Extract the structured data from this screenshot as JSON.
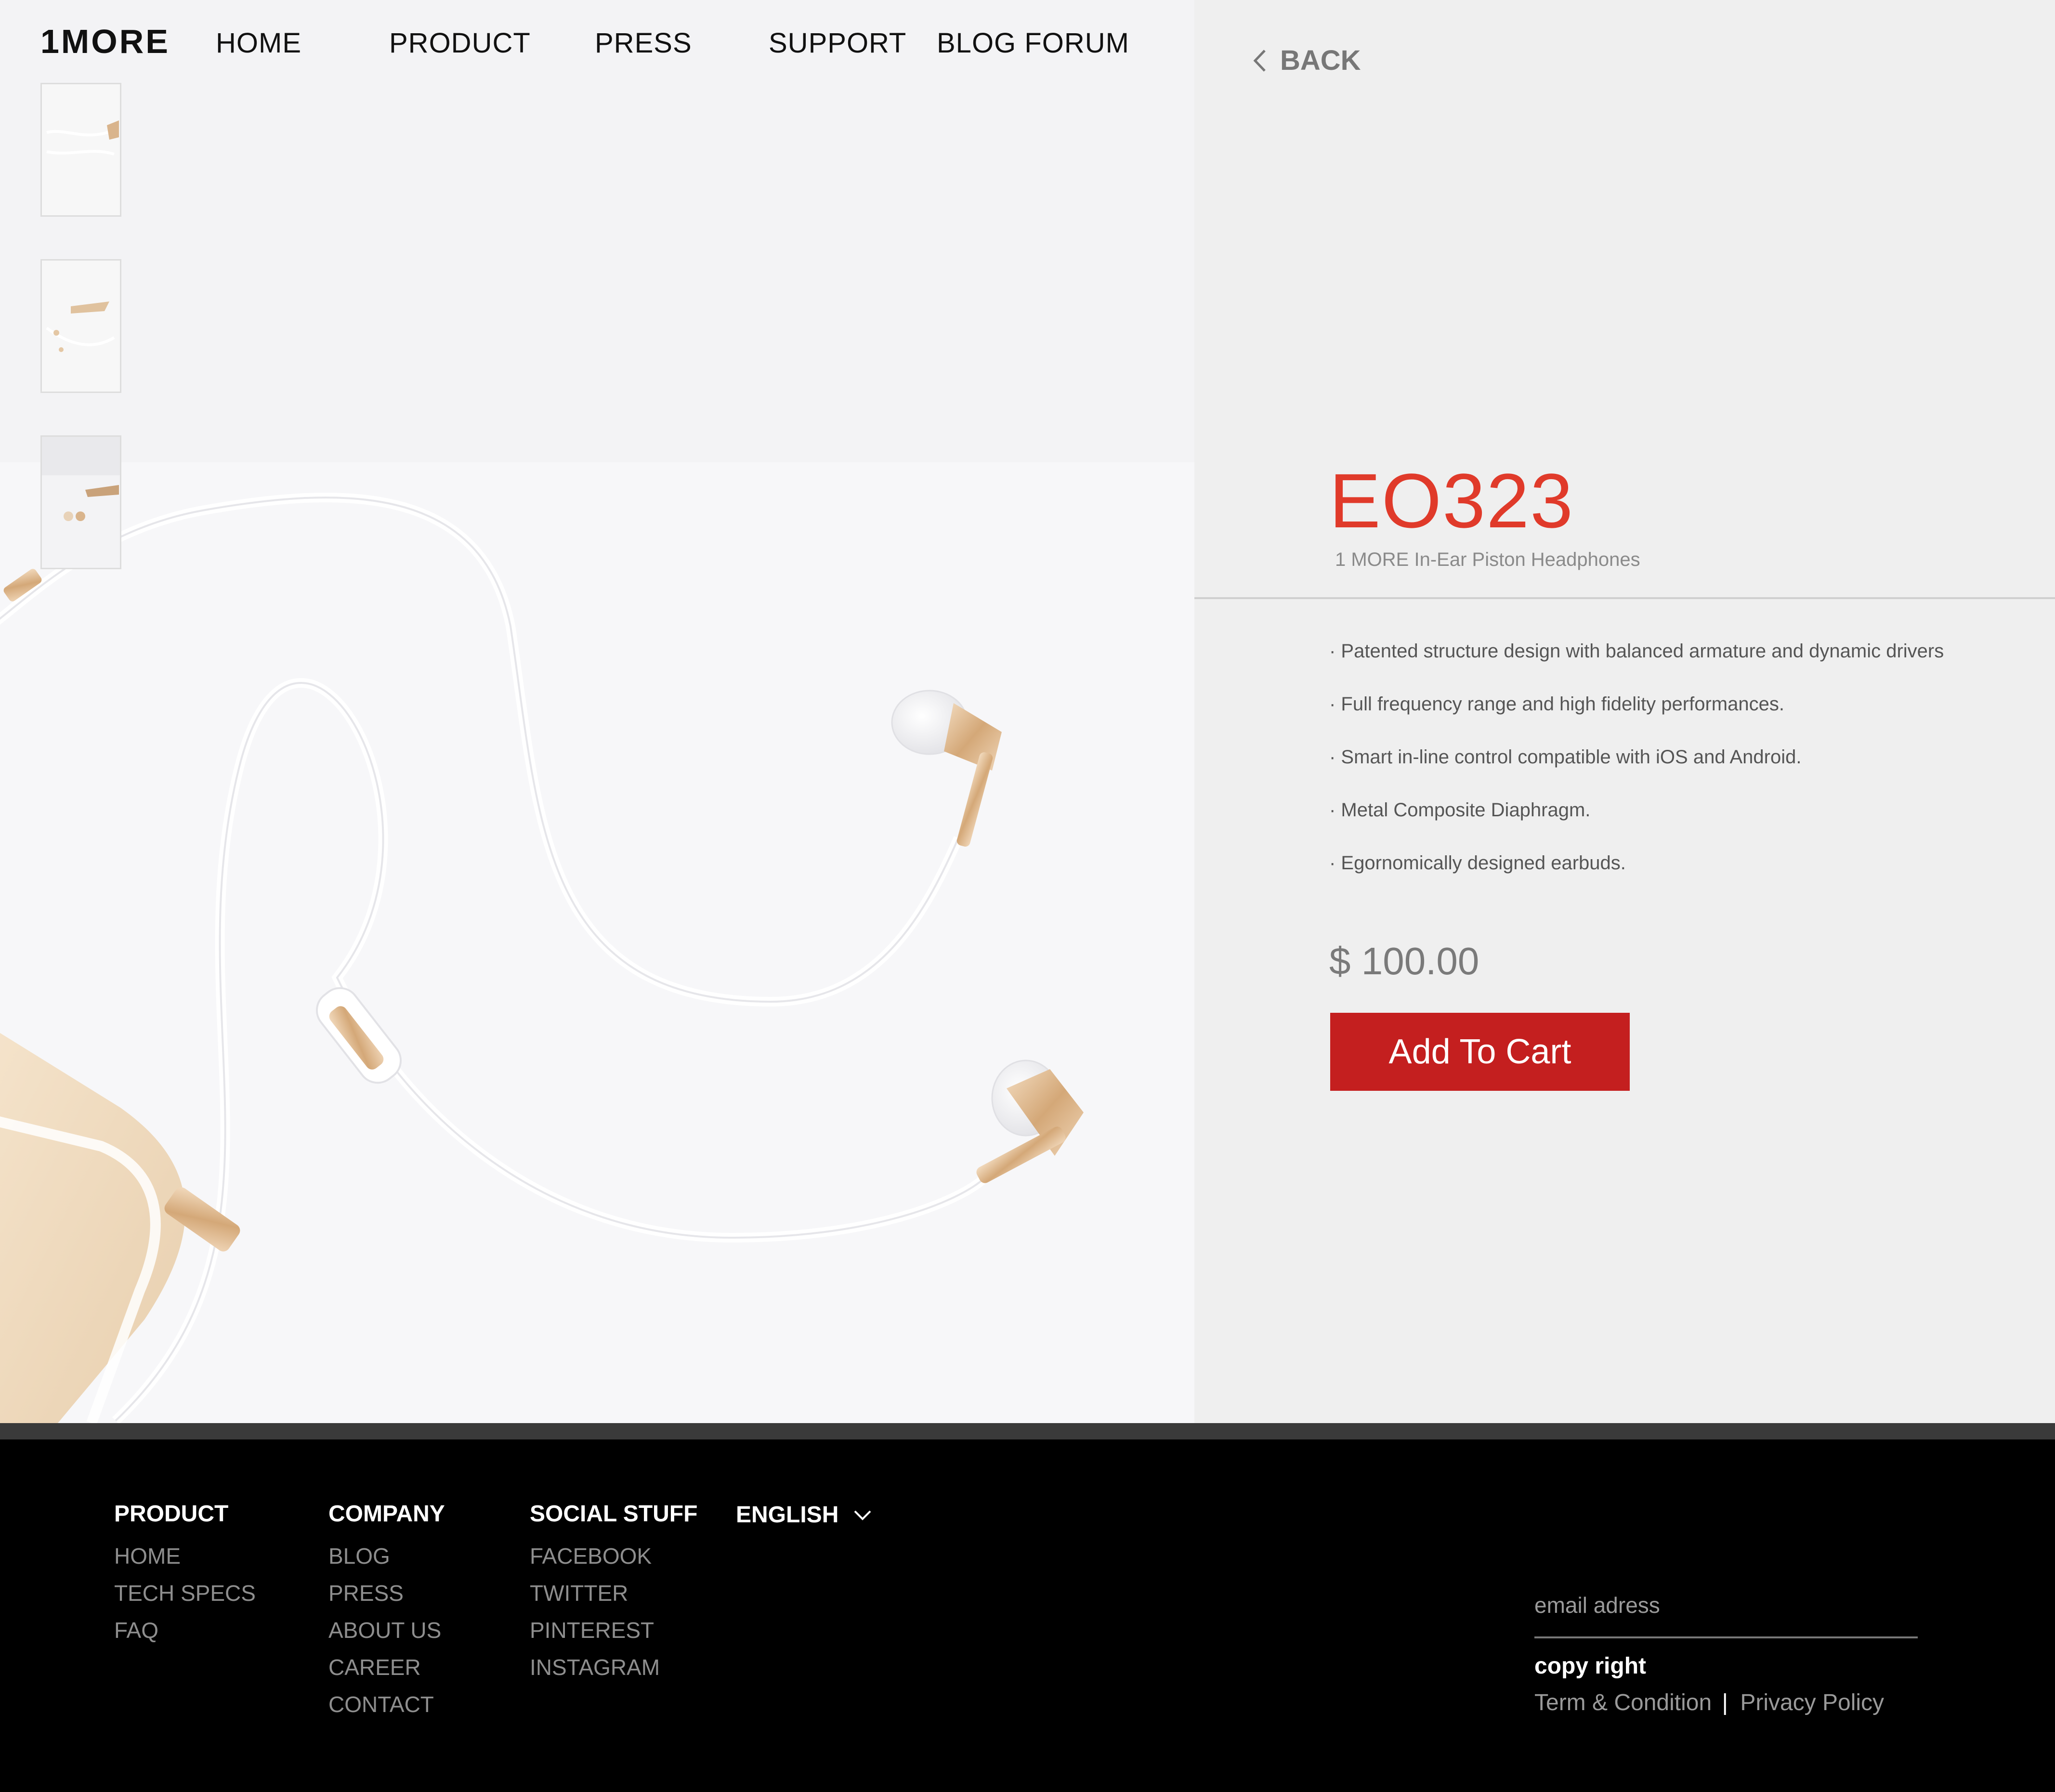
{
  "brand": {
    "logo_text": "1MORE"
  },
  "nav": [
    {
      "label": "HOME"
    },
    {
      "label": "PRODUCT"
    },
    {
      "label": "PRESS"
    },
    {
      "label": "SUPPORT"
    },
    {
      "label": "BLOG FORUM"
    }
  ],
  "back": {
    "label": "BACK",
    "icon": "chevron-left-icon"
  },
  "product": {
    "model": "EO323",
    "subtitle": "1 MORE In-Ear Piston Headphones",
    "features": [
      " · Patented structure design with balanced armature and dynamic drivers",
      "· Full frequency range and high fidelity performances.",
      "· Smart in-line control compatible with iOS and Android.",
      "· Metal Composite Diaphragm.",
      "· Egornomically designed earbuds."
    ],
    "price": "$ 100.00",
    "add_to_cart": "Add To Cart"
  },
  "footer": {
    "product": {
      "heading": "PRODUCT",
      "links": [
        "HOME",
        "TECH SPECS",
        "FAQ"
      ]
    },
    "company": {
      "heading": "COMPANY",
      "links": [
        "BLOG",
        "PRESS",
        "ABOUT US",
        "CAREER",
        "CONTACT"
      ]
    },
    "social": {
      "heading": "SOCIAL STUFF",
      "links": [
        "FACEBOOK",
        "TWITTER",
        "PINTEREST",
        "INSTAGRAM"
      ]
    },
    "language": {
      "label": "ENGLISH",
      "icon": "chevron-down-icon"
    },
    "email_placeholder": "email adress",
    "copyright": "copy right",
    "terms": "Term & Condition",
    "separator": "|",
    "privacy": "Privacy Policy"
  },
  "colors": {
    "accent": "#e03a2a",
    "button": "#c41f1f",
    "footer_bg": "#000000",
    "panel_bg": "#efefef"
  }
}
